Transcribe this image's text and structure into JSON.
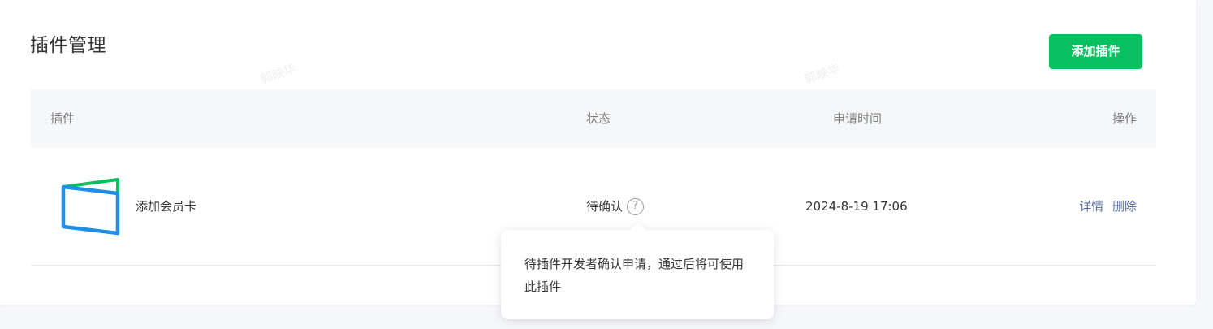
{
  "page": {
    "title": "插件管理",
    "add_button_label": "添加插件",
    "watermark": "郭映华"
  },
  "table": {
    "headers": {
      "plugin": "插件",
      "status": "状态",
      "apply_time": "申请时间",
      "actions": "操作"
    },
    "rows": [
      {
        "icon": "membership-card-icon",
        "name": "添加会员卡",
        "status": "待确认",
        "apply_time": "2024-8-19 17:06",
        "actions": {
          "detail": "详情",
          "delete": "删除"
        }
      }
    ]
  },
  "tooltip": {
    "text": "待插件开发者确认申请，通过后将可使用此插件"
  },
  "colors": {
    "accent": "#07c160",
    "link": "#576b95",
    "icon_blue": "#1e8ee8",
    "icon_green": "#07c160"
  }
}
